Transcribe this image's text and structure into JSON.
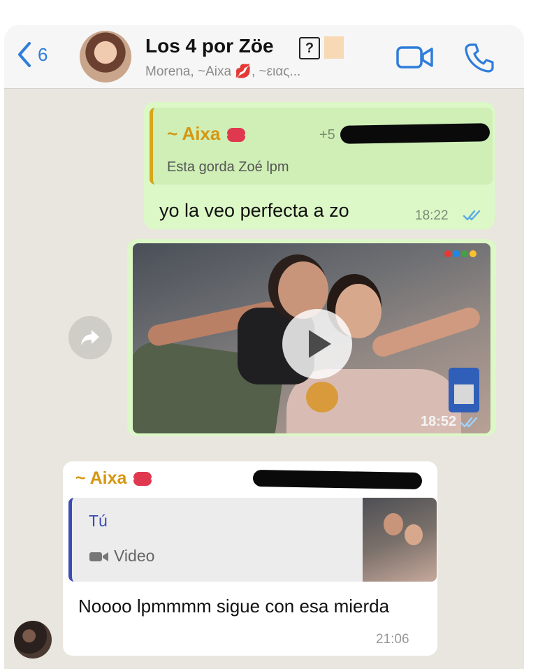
{
  "header": {
    "back_count": "6",
    "title": "Los 4 por Zöe",
    "title_badge": "?",
    "members": "Morena, ~Aixa 💋, ~ειας...",
    "video_icon": "video-camera-icon",
    "call_icon": "phone-icon"
  },
  "messages": [
    {
      "quote_author": "~ Aixa",
      "quote_phone_prefix": "+5",
      "quote_text": "Esta gorda Zoé lpm",
      "text": "yo la veo perfecta a zo",
      "time": "18:22"
    },
    {
      "type": "video",
      "time": "18:52"
    },
    {
      "author": "~ Aixa",
      "quote_author": "Tú",
      "quote_type": "Video",
      "text": "Noooo lpmmmm sigue con esa mierda",
      "time": "21:06"
    }
  ],
  "colors": {
    "accent_blue": "#2f7ddb",
    "outgoing_bubble": "#dcf8c6",
    "incoming_bubble": "#ffffff",
    "chat_background": "#e9e6df",
    "quote_author_orange": "#d69712",
    "quote_bar_blue": "#3d4bb5"
  }
}
